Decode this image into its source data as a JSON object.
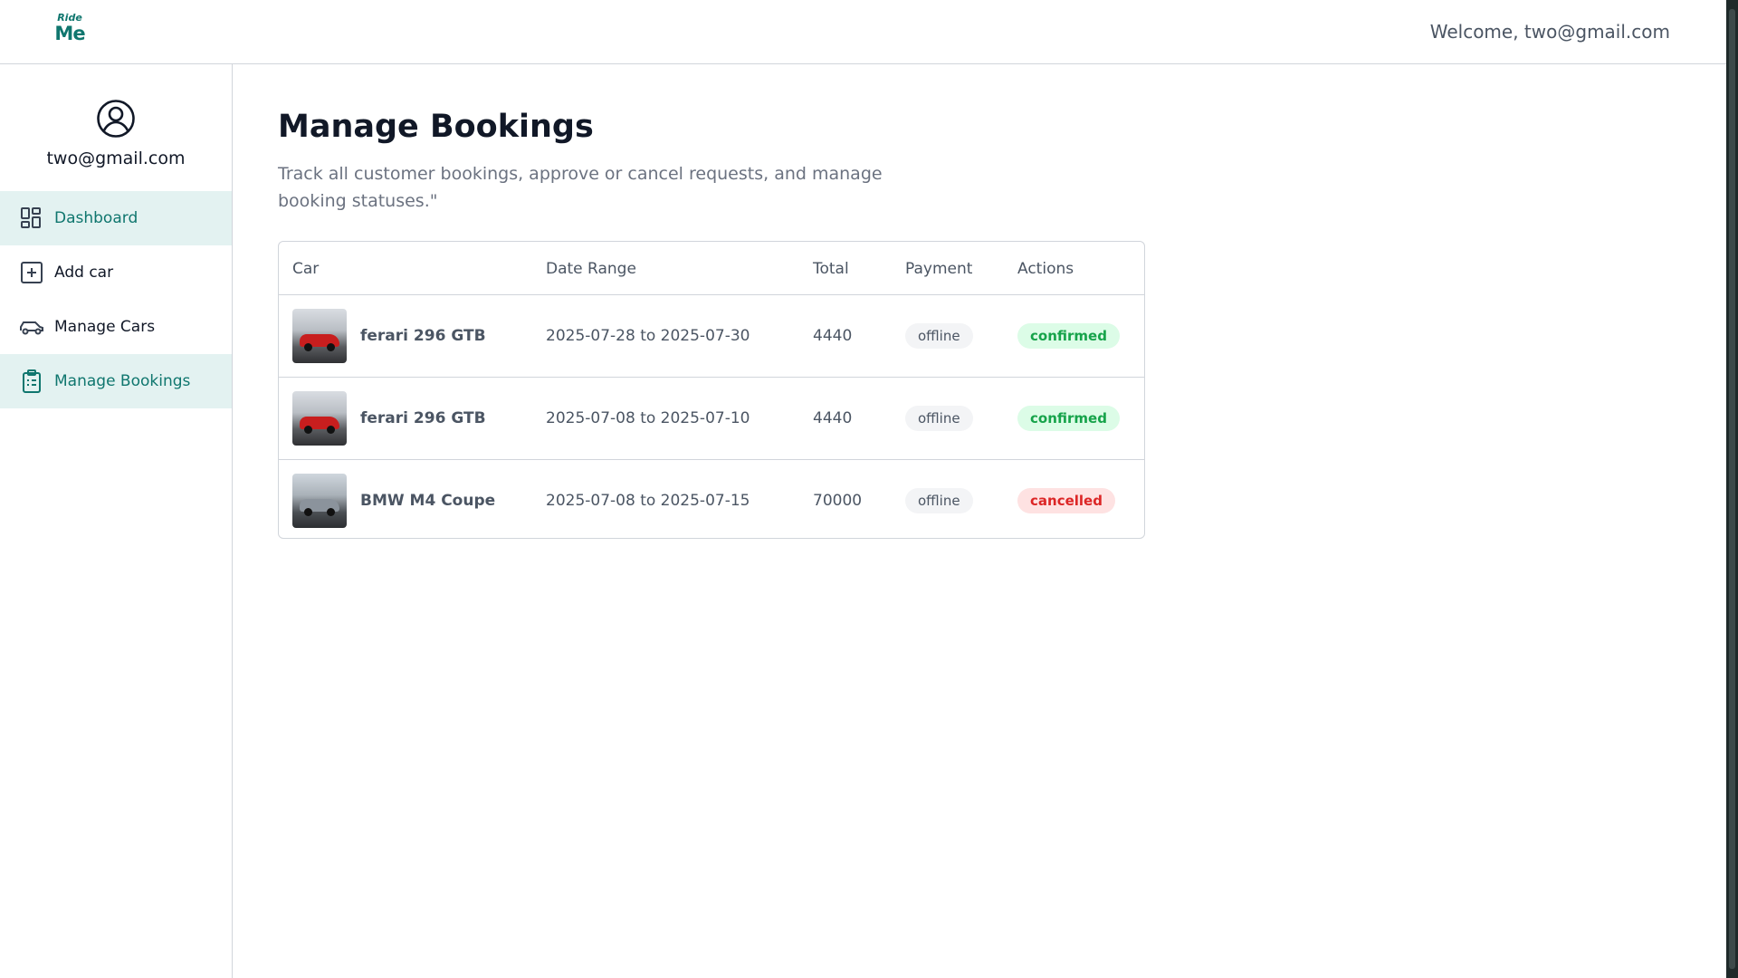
{
  "header": {
    "logo_line1": "Ride",
    "logo_line2": "Me",
    "welcome": "Welcome, two@gmail.com"
  },
  "sidebar": {
    "email": "two@gmail.com",
    "items": [
      {
        "label": "Dashboard",
        "icon": "dashboard-icon",
        "active": true
      },
      {
        "label": "Add car",
        "icon": "plus-square-icon",
        "active": false
      },
      {
        "label": "Manage Cars",
        "icon": "car-icon",
        "active": false
      },
      {
        "label": "Manage Bookings",
        "icon": "clipboard-list-icon",
        "active": true
      }
    ]
  },
  "main": {
    "title": "Manage Bookings",
    "subtitle": "Track all customer bookings, approve or cancel requests, and manage booking statuses.\"",
    "table": {
      "headers": [
        "Car",
        "Date Range",
        "Total",
        "Payment",
        "Actions"
      ],
      "rows": [
        {
          "car": "ferari 296 GTB",
          "date_range": "2025-07-28 to 2025-07-30",
          "total": "4440",
          "payment": "offline",
          "status": "confirmed"
        },
        {
          "car": "ferari 296 GTB",
          "date_range": "2025-07-08 to 2025-07-10",
          "total": "4440",
          "payment": "offline",
          "status": "confirmed"
        },
        {
          "car": "BMW M4 Coupe",
          "date_range": "2025-07-08 to 2025-07-15",
          "total": "70000",
          "payment": "offline",
          "status": "cancelled"
        }
      ]
    }
  },
  "colors": {
    "accent": "#0f766e",
    "active_bg": "#e3f2f1",
    "confirmed": "#16a34a",
    "cancelled": "#dc2626"
  }
}
